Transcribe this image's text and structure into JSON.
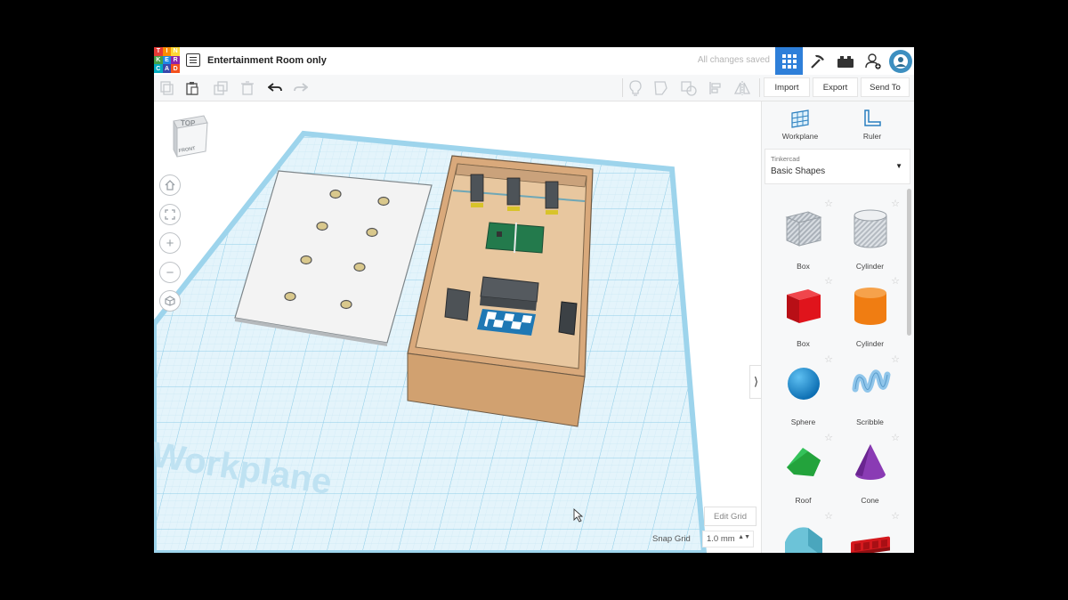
{
  "window": {
    "title": "Entertainment Room only",
    "status": "All changes saved",
    "logo_letters": [
      "T",
      "I",
      "N",
      "K",
      "E",
      "R",
      "C",
      "A",
      "D"
    ],
    "logo_colors": [
      "#e53935",
      "#fb8c00",
      "#fdd835",
      "#43a047",
      "#1e88e5",
      "#8e24aa",
      "#00acc1",
      "#3949ab",
      "#f4511e"
    ]
  },
  "toolbar": {
    "import_label": "Import",
    "export_label": "Export",
    "send_to_label": "Send To"
  },
  "canvas": {
    "workplane_label": "Workplane",
    "viewcube_top": "TOP",
    "viewcube_front": "FRONT",
    "edit_grid_label": "Edit Grid",
    "snap_grid_label": "Snap Grid",
    "snap_grid_value": "1.0 mm"
  },
  "panel": {
    "workplane_label": "Workplane",
    "ruler_label": "Ruler",
    "library_provider": "Tinkercad",
    "library_name": "Basic Shapes",
    "shapes": [
      {
        "label": "Box",
        "color": "#b9c0c8"
      },
      {
        "label": "Cylinder",
        "color": "#c4c9cf"
      },
      {
        "label": "Box",
        "color": "#e0141c"
      },
      {
        "label": "Cylinder",
        "color": "#f07d12"
      },
      {
        "label": "Sphere",
        "color": "#1b8fd8"
      },
      {
        "label": "Scribble",
        "color": "#8fc5ea"
      },
      {
        "label": "Roof",
        "color": "#23a33c"
      },
      {
        "label": "Cone",
        "color": "#8a3bb4"
      },
      {
        "label": "",
        "color": "#6cc3d8"
      },
      {
        "label": "",
        "color": "#d4191e"
      }
    ]
  },
  "colors": {
    "accent": "#2e7fd9",
    "grid_blue": "#9dd4ec",
    "room_floor": "#e8c79f",
    "room_wall": "#d7a97c"
  }
}
